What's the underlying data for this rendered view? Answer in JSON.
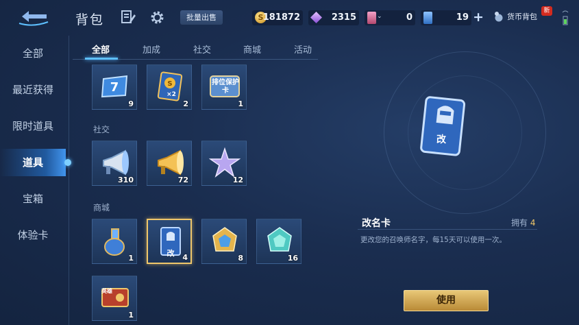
{
  "header": {
    "title": "背包",
    "batch_sell": "批量出售",
    "resources": [
      {
        "icon": "gold-coin-icon",
        "value": "181872"
      },
      {
        "icon": "diamond-icon",
        "value": "2315"
      },
      {
        "icon": "pink-card-icon",
        "value": "0"
      },
      {
        "icon": "blue-card-icon",
        "value": "19"
      }
    ],
    "wallet_label": "货币背包",
    "new_badge": "新"
  },
  "sidebar": {
    "items": [
      {
        "label": "全部"
      },
      {
        "label": "最近获得"
      },
      {
        "label": "限时道具"
      },
      {
        "label": "道具",
        "active": true
      },
      {
        "label": "宝箱"
      },
      {
        "label": "体验卡"
      }
    ]
  },
  "tabs": [
    {
      "label": "全部",
      "active": true
    },
    {
      "label": "加成"
    },
    {
      "label": "社交"
    },
    {
      "label": "商城"
    },
    {
      "label": "活动"
    }
  ],
  "sections": {
    "bonus": {
      "items": [
        {
          "icon": "7-day-card-icon",
          "count": "9"
        },
        {
          "icon": "double-gold-card-icon",
          "count": "2"
        },
        {
          "icon": "rank-protection-card-icon",
          "count": "1",
          "label": "排位保护卡"
        }
      ]
    },
    "social": {
      "title": "社交",
      "items": [
        {
          "icon": "loudspeaker-icon",
          "count": "310"
        },
        {
          "icon": "golden-horn-icon",
          "count": "72"
        },
        {
          "icon": "star-icon",
          "count": "12"
        }
      ]
    },
    "mall": {
      "title": "商城",
      "items": [
        {
          "icon": "potion-bottle-icon",
          "count": "1"
        },
        {
          "icon": "rename-card-icon",
          "count": "4",
          "label": "改",
          "selected": true
        },
        {
          "icon": "gold-crystal-icon",
          "count": "8"
        },
        {
          "icon": "jade-crystal-icon",
          "count": "16"
        },
        {
          "icon": "hero-card-icon",
          "count": "1",
          "label": "英雄"
        }
      ]
    }
  },
  "detail": {
    "name": "改名卡",
    "owned_label": "拥有",
    "owned_count": "4",
    "description": "更改您的召唤师名字，每15天可以使用一次。",
    "use_button": "使用",
    "card_label": "改"
  },
  "colors": {
    "accent": "#5ec0ff",
    "gold": "#f0c76a",
    "bg": "#1a2d4f"
  }
}
